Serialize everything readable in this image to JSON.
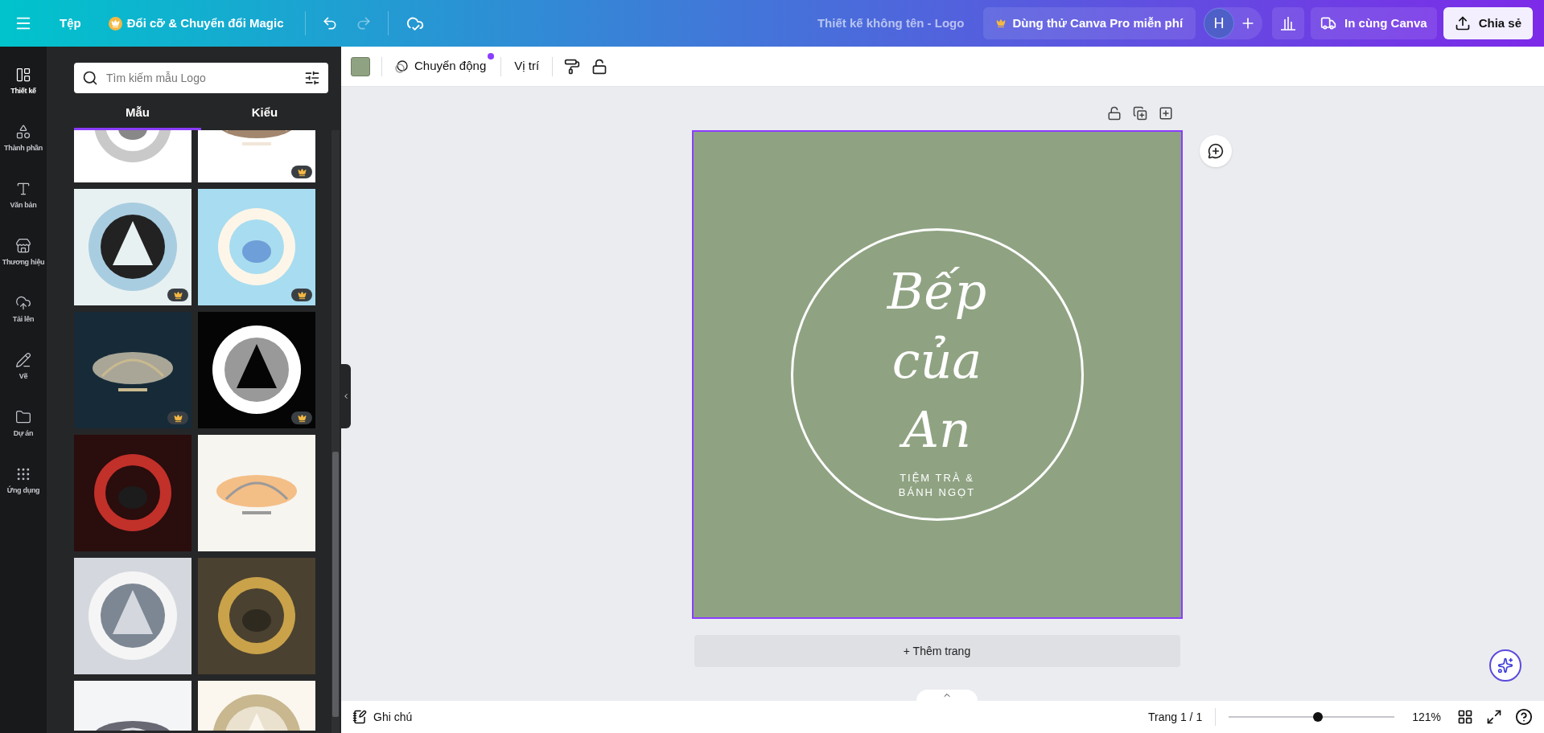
{
  "topbar": {
    "menu_item": "Tệp",
    "magic_button": "Đổi cỡ & Chuyển đổi Magic",
    "redo_disabled": true,
    "document_title": "Thiết kế không tên - Logo",
    "pro_button": "Dùng thử Canva Pro miễn phí",
    "avatar": "H",
    "print_button": "In cùng Canva",
    "share_button": "Chia sẻ"
  },
  "rail": {
    "items": [
      {
        "label": "Thiết kế",
        "kind": "design",
        "selected": true
      },
      {
        "label": "Thành phần",
        "kind": "elements",
        "selected": false
      },
      {
        "label": "Văn bản",
        "kind": "text",
        "selected": false
      },
      {
        "label": "Thương hiệu",
        "kind": "brand",
        "selected": false
      },
      {
        "label": "Tải lên",
        "kind": "upload",
        "selected": false
      },
      {
        "label": "Vẽ",
        "kind": "draw",
        "selected": false
      },
      {
        "label": "Dự án",
        "kind": "projects",
        "selected": false
      },
      {
        "label": "Ứng dụng",
        "kind": "apps",
        "selected": false
      }
    ]
  },
  "panel": {
    "search": {
      "placeholder": "Tìm kiếm mẫu Logo"
    },
    "tabs": [
      {
        "label": "Mẫu",
        "selected": true
      },
      {
        "label": "Kiểu",
        "selected": false
      }
    ],
    "templates": [
      {
        "kind": "picture",
        "premium": false
      },
      {
        "kind": "picture",
        "premium": true
      },
      {
        "kind": "picture",
        "premium": true
      },
      {
        "kind": "picture",
        "premium": true
      },
      {
        "kind": "picture",
        "premium": true
      },
      {
        "kind": "picture",
        "premium": true
      },
      {
        "kind": "picture",
        "premium": false
      },
      {
        "kind": "picture",
        "premium": false
      },
      {
        "kind": "picture",
        "premium": false
      },
      {
        "kind": "picture",
        "premium": false
      },
      {
        "kind": "picture",
        "premium": false
      },
      {
        "kind": "picture",
        "premium": false
      }
    ]
  },
  "toolbar": {
    "color": "#8fa382",
    "motion": "Chuyển động",
    "motion_dot": true,
    "position": "Vị trí"
  },
  "design": {
    "title_lines": [
      "Bếp",
      "của",
      "An"
    ],
    "subtitle_lines": [
      "TIỆM TRÀ &",
      "BÁNH NGỌT"
    ]
  },
  "add_page": "+ Thêm trang",
  "footer": {
    "notes": "Ghi chú",
    "page": "Trang 1 / 1",
    "zoom": {
      "level": 0.54
    },
    "zoom_text": "121%"
  }
}
